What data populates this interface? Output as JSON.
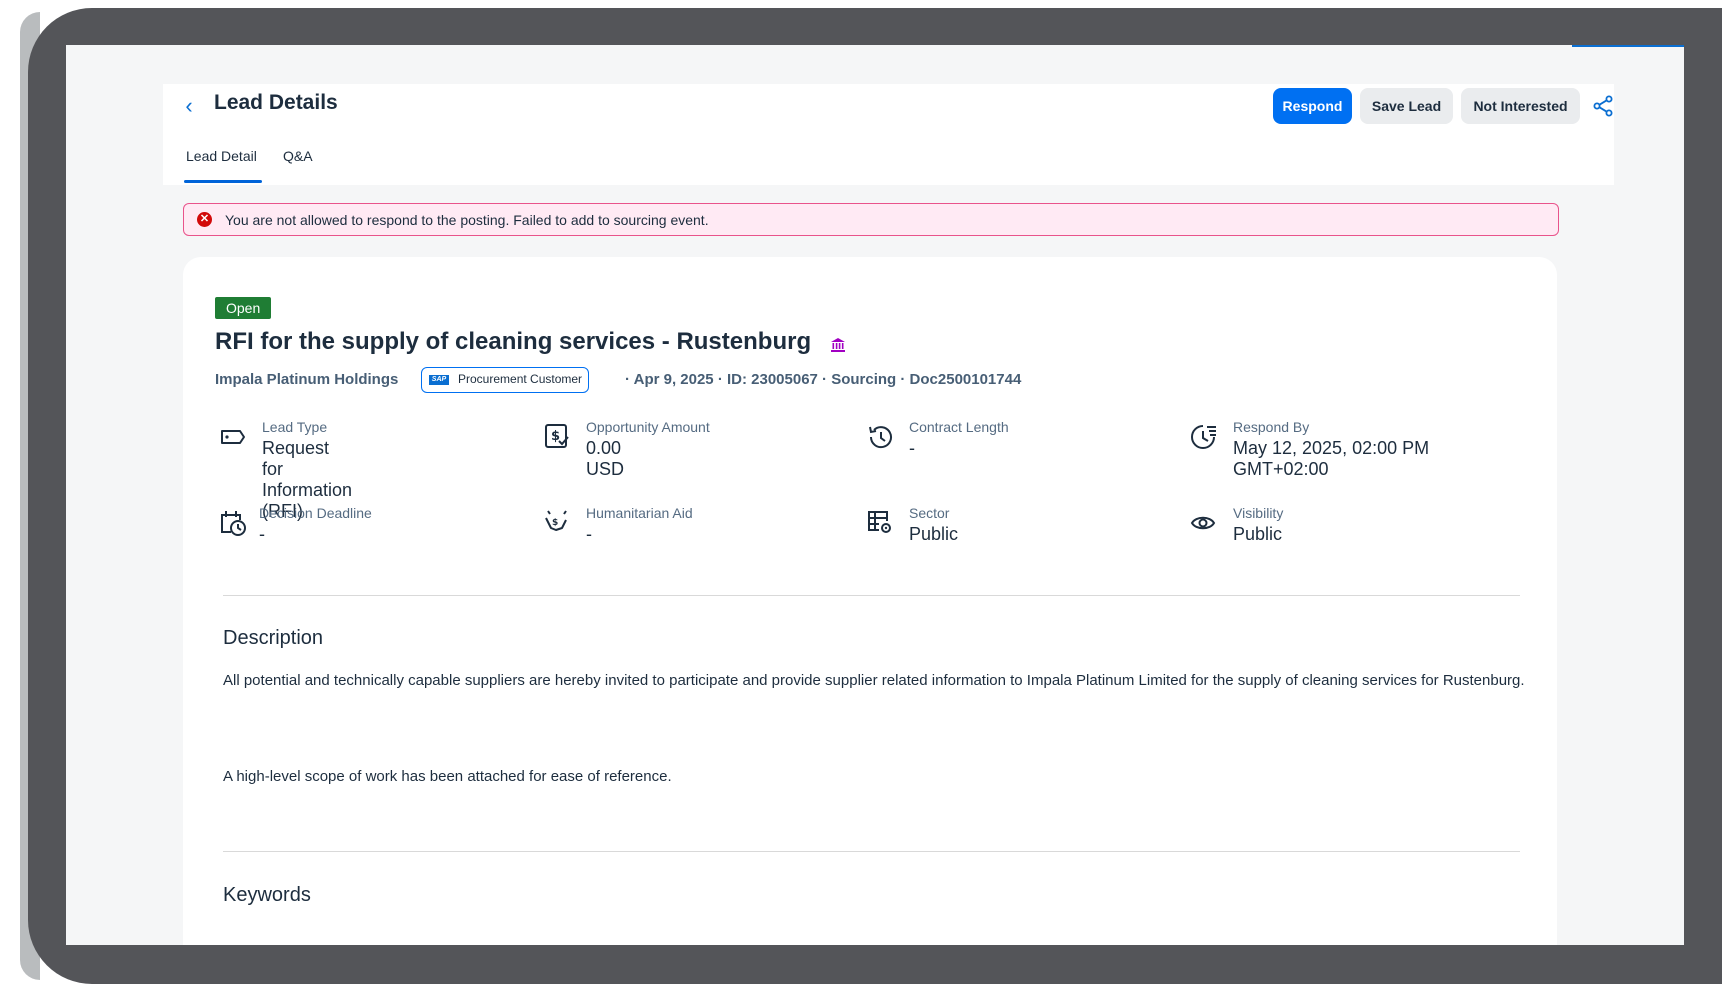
{
  "header": {
    "back_icon": "chevron-left-icon",
    "title": "Lead Details",
    "respond_label": "Respond",
    "save_label": "Save Lead",
    "not_interested_label": "Not Interested",
    "share_icon": "share-icon",
    "accent_color": "#0070f2"
  },
  "tabs": [
    {
      "label": "Lead Detail",
      "active": true
    },
    {
      "label": "Q&A",
      "active": false
    }
  ],
  "alert": {
    "icon": "error-icon",
    "text": "You are not allowed to respond to the posting. Failed to add to sourcing event.",
    "color": "#d20a0a"
  },
  "lead": {
    "status": "Open",
    "status_color": "#1f7d34",
    "title": "RFI for the supply of cleaning services - Rustenburg",
    "title_icon": "government-building-icon",
    "buyer": "Impala Platinum Holdings",
    "badge_label": "Procurement Customer",
    "meta_rest": "· Apr 9, 2025 · ID: 23005067 · Sourcing · Doc2500101744"
  },
  "fields": [
    {
      "label": "Lead Type",
      "value": "Request for Information (RFI)",
      "icon": "tag-icon"
    },
    {
      "label": "Opportunity Amount",
      "value": "0.00 USD",
      "icon": "money-check-icon"
    },
    {
      "label": "Contract Length",
      "value": "-",
      "icon": "history-icon"
    },
    {
      "label": "Respond By",
      "value": "May 12, 2025, 02:00 PM GMT+02:00",
      "icon": "deadline-list-icon"
    },
    {
      "label": "Decision Deadline",
      "value": "-",
      "icon": "calendar-clock-icon"
    },
    {
      "label": "Humanitarian Aid",
      "value": "-",
      "icon": "helping-hand-icon"
    },
    {
      "label": "Sector",
      "value": "Public",
      "icon": "grid-settings-icon"
    },
    {
      "label": "Visibility",
      "value": "Public",
      "icon": "eye-icon"
    }
  ],
  "description": {
    "title": "Description",
    "para1": "All potential and technically capable suppliers are hereby invited to participate and provide supplier related information to Impala Platinum Limited for the supply of cleaning services for Rustenburg.",
    "para2": "A high-level scope of work has been attached for ease of reference."
  },
  "keywords": {
    "title": "Keywords"
  }
}
